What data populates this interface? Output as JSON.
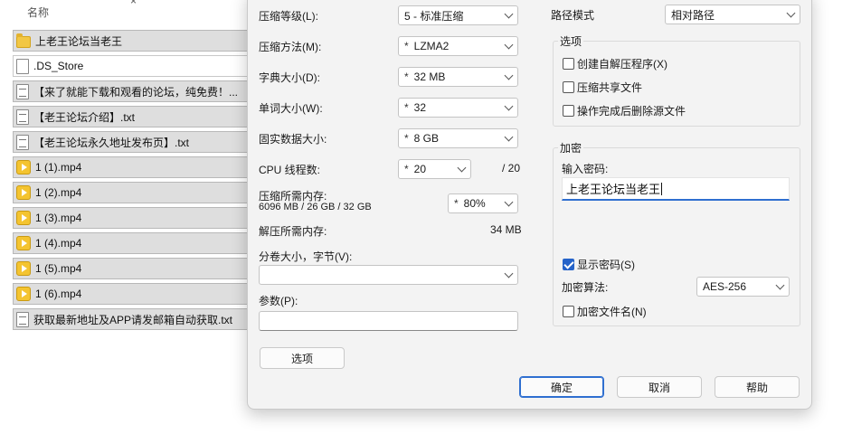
{
  "filelist": {
    "header": "名称",
    "files": [
      {
        "name": "上老王论坛当老王",
        "type": "folder"
      },
      {
        "name": ".DS_Store",
        "type": "file"
      },
      {
        "name": "【来了就能下载和观看的论坛，纯免费！...",
        "type": "txt"
      },
      {
        "name": "【老王论坛介绍】.txt",
        "type": "txt"
      },
      {
        "name": "【老王论坛永久地址发布页】.txt",
        "type": "txt"
      },
      {
        "name": "1 (1).mp4",
        "type": "video"
      },
      {
        "name": "1 (2).mp4",
        "type": "video"
      },
      {
        "name": "1 (3).mp4",
        "type": "video"
      },
      {
        "name": "1 (4).mp4",
        "type": "video"
      },
      {
        "name": "1 (5).mp4",
        "type": "video"
      },
      {
        "name": "1 (6).mp4",
        "type": "video"
      },
      {
        "name": "获取最新地址及APP请发邮箱自动获取.txt",
        "type": "txt"
      }
    ]
  },
  "dialog": {
    "level_label": "压缩等级(L):",
    "level_value": "5 - 标准压缩",
    "method_label": "压缩方法(M):",
    "method_value": "LZMA2",
    "dict_label": "字典大小(D):",
    "dict_value": "32 MB",
    "word_label": "单词大小(W):",
    "word_value": "32",
    "solid_label": "固实数据大小:",
    "solid_value": "8 GB",
    "threads_label": "CPU 线程数:",
    "threads_value": "20",
    "threads_max": "/ 20",
    "mem_comp_label": "压缩所需内存:",
    "mem_comp_value": "6096 MB / 26 GB / 32 GB",
    "mem_percent": "80%",
    "mem_decomp_label": "解压所需内存:",
    "mem_decomp_value": "34 MB",
    "volume_label": "分卷大小，字节(V):",
    "volume_value": "",
    "params_label": "参数(P):",
    "params_value": "",
    "options_button": "选项",
    "path_mode_label": "路径模式",
    "path_mode_value": "相对路径",
    "star": "*",
    "options_group": {
      "title": "选项",
      "sfx": "创建自解压程序(X)",
      "shared": "压缩共享文件",
      "delete_after": "操作完成后删除源文件"
    },
    "encrypt_group": {
      "title": "加密",
      "password_label": "输入密码:",
      "password_value": "上老王论坛当老王",
      "show_password": "显示密码(S)",
      "method_label": "加密算法:",
      "method_value": "AES-256",
      "encrypt_names": "加密文件名(N)"
    },
    "ok_button": "确定",
    "cancel_button": "取消",
    "help_button": "帮助"
  }
}
